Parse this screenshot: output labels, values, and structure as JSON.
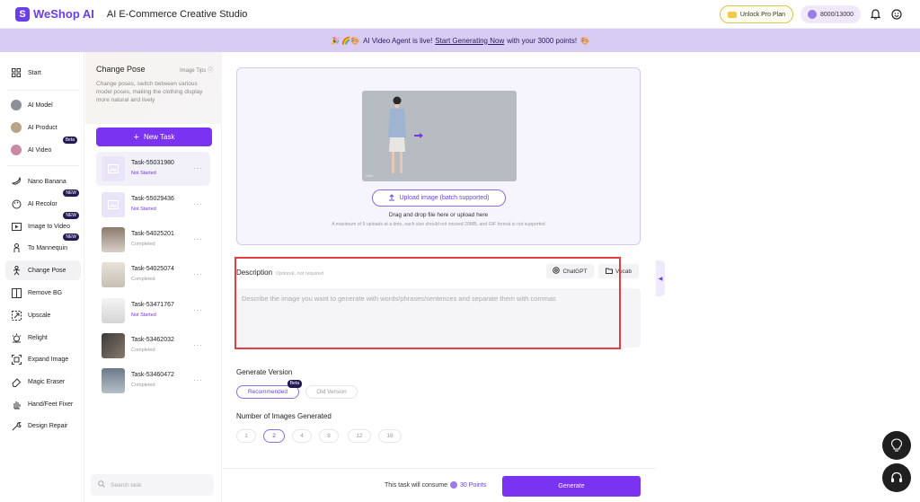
{
  "header": {
    "logo_mark": "S",
    "logo_text": "WeShop AI",
    "app_title": "AI E-Commerce Creative Studio",
    "pro_label": "Unlock Pro Plan",
    "points_label": "8000/13000"
  },
  "banner": {
    "emoji_prefix": "🎉 🌈🎨",
    "text_before": "AI Video Agent is live!",
    "link": "Start Generating Now",
    "text_after": "with your 3000 points!",
    "emoji_suffix": "🎨"
  },
  "nav": {
    "start": "Start",
    "ai_model": "AI Model",
    "ai_product": "AI Product",
    "ai_video": "AI Video",
    "ai_video_tag": "Beta",
    "nano_banana": "Nano Banana",
    "ai_recolor": "AI Recolor",
    "ai_recolor_tag": "NEW",
    "image_to_video": "Image to Video",
    "image_to_video_tag": "NEW",
    "to_mannequin": "To Mannequin",
    "to_mannequin_tag": "NEW",
    "change_pose": "Change Pose",
    "remove_bg": "Remove BG",
    "upscale": "Upscale",
    "relight": "Relight",
    "expand_image": "Expand Image",
    "magic_eraser": "Magic Eraser",
    "hand_feet_fixer": "Hand/Feet Fixer",
    "design_repair": "Design Repair"
  },
  "task_panel": {
    "title": "Change Pose",
    "tips": "Image Tips",
    "description": "Change poses, switch between various model poses, making the clothing display more natural and lively",
    "new_task_label": "New Task",
    "tasks": [
      {
        "name": "Task-55031980",
        "status": "Not Started"
      },
      {
        "name": "Task-55029436",
        "status": "Not Started"
      },
      {
        "name": "Task-54025201",
        "status": "Completed"
      },
      {
        "name": "Task-54025074",
        "status": "Completed"
      },
      {
        "name": "Task-53471767",
        "status": "Not Started"
      },
      {
        "name": "Task-53462032",
        "status": "Completed"
      },
      {
        "name": "Task-53460472",
        "status": "Completed"
      }
    ],
    "search_placeholder": "Search task"
  },
  "main": {
    "preview_caption": "After",
    "upload_label": "Upload image (batch supported)",
    "drag_text": "Drag and drop file here or upload here",
    "limit_text": "A maximum of 9 uploads at a time, each size should not exceed 20MB, and GIF format is not supported",
    "description_label": "Description",
    "description_optional": "Optional, not required",
    "chatgpt_label": "ChatGPT",
    "vocab_label": "Vocab",
    "description_placeholder": "Describe the image you want to generate with words/phrases/sentences and separate them with commas",
    "version_label": "Generate Version",
    "version_recommended": "Recommended",
    "version_beta_tag": "Beta",
    "version_old": "Old Version",
    "num_label": "Number of Images Generated",
    "num_options": [
      "1",
      "2",
      "4",
      "8",
      "12",
      "16"
    ],
    "selected_num": "2",
    "consume_text": "This task will consume",
    "consume_points": "30 Points",
    "generate_label": "Generate"
  },
  "colors": {
    "accent": "#7a33f0",
    "banner_bg": "#d9ccf3",
    "highlight": "#e04040"
  }
}
